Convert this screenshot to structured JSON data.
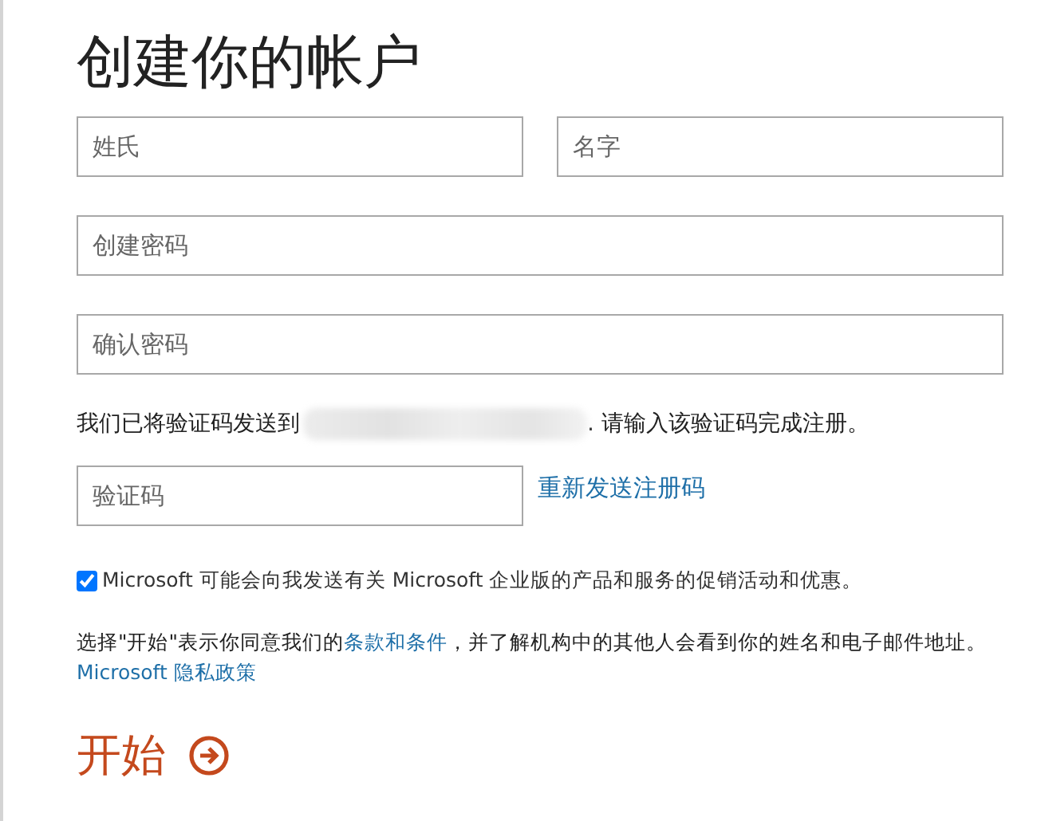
{
  "title": "创建你的帐户",
  "name_fields": [
    {
      "placeholder": "姓氏"
    },
    {
      "placeholder": "名字"
    }
  ],
  "password_fields": [
    {
      "placeholder": "创建密码"
    },
    {
      "placeholder": "确认密码"
    }
  ],
  "notice": {
    "before": "我们已将验证码发送到",
    "after": ". 请输入该验证码完成注册。"
  },
  "code_field": {
    "placeholder": "验证码"
  },
  "resend_link": "重新发送注册码",
  "marketing": {
    "checked": true,
    "label": "Microsoft 可能会向我发送有关 Microsoft 企业版的产品和服务的促销活动和优惠。"
  },
  "terms": {
    "before": "选择\"开始\"表示你同意我们的",
    "link": "条款和条件",
    "after": "，并了解机构中的其他人会看到你的姓名和电子邮件地址。"
  },
  "privacy_link": "Microsoft 隐私政策",
  "start_button": "开始"
}
